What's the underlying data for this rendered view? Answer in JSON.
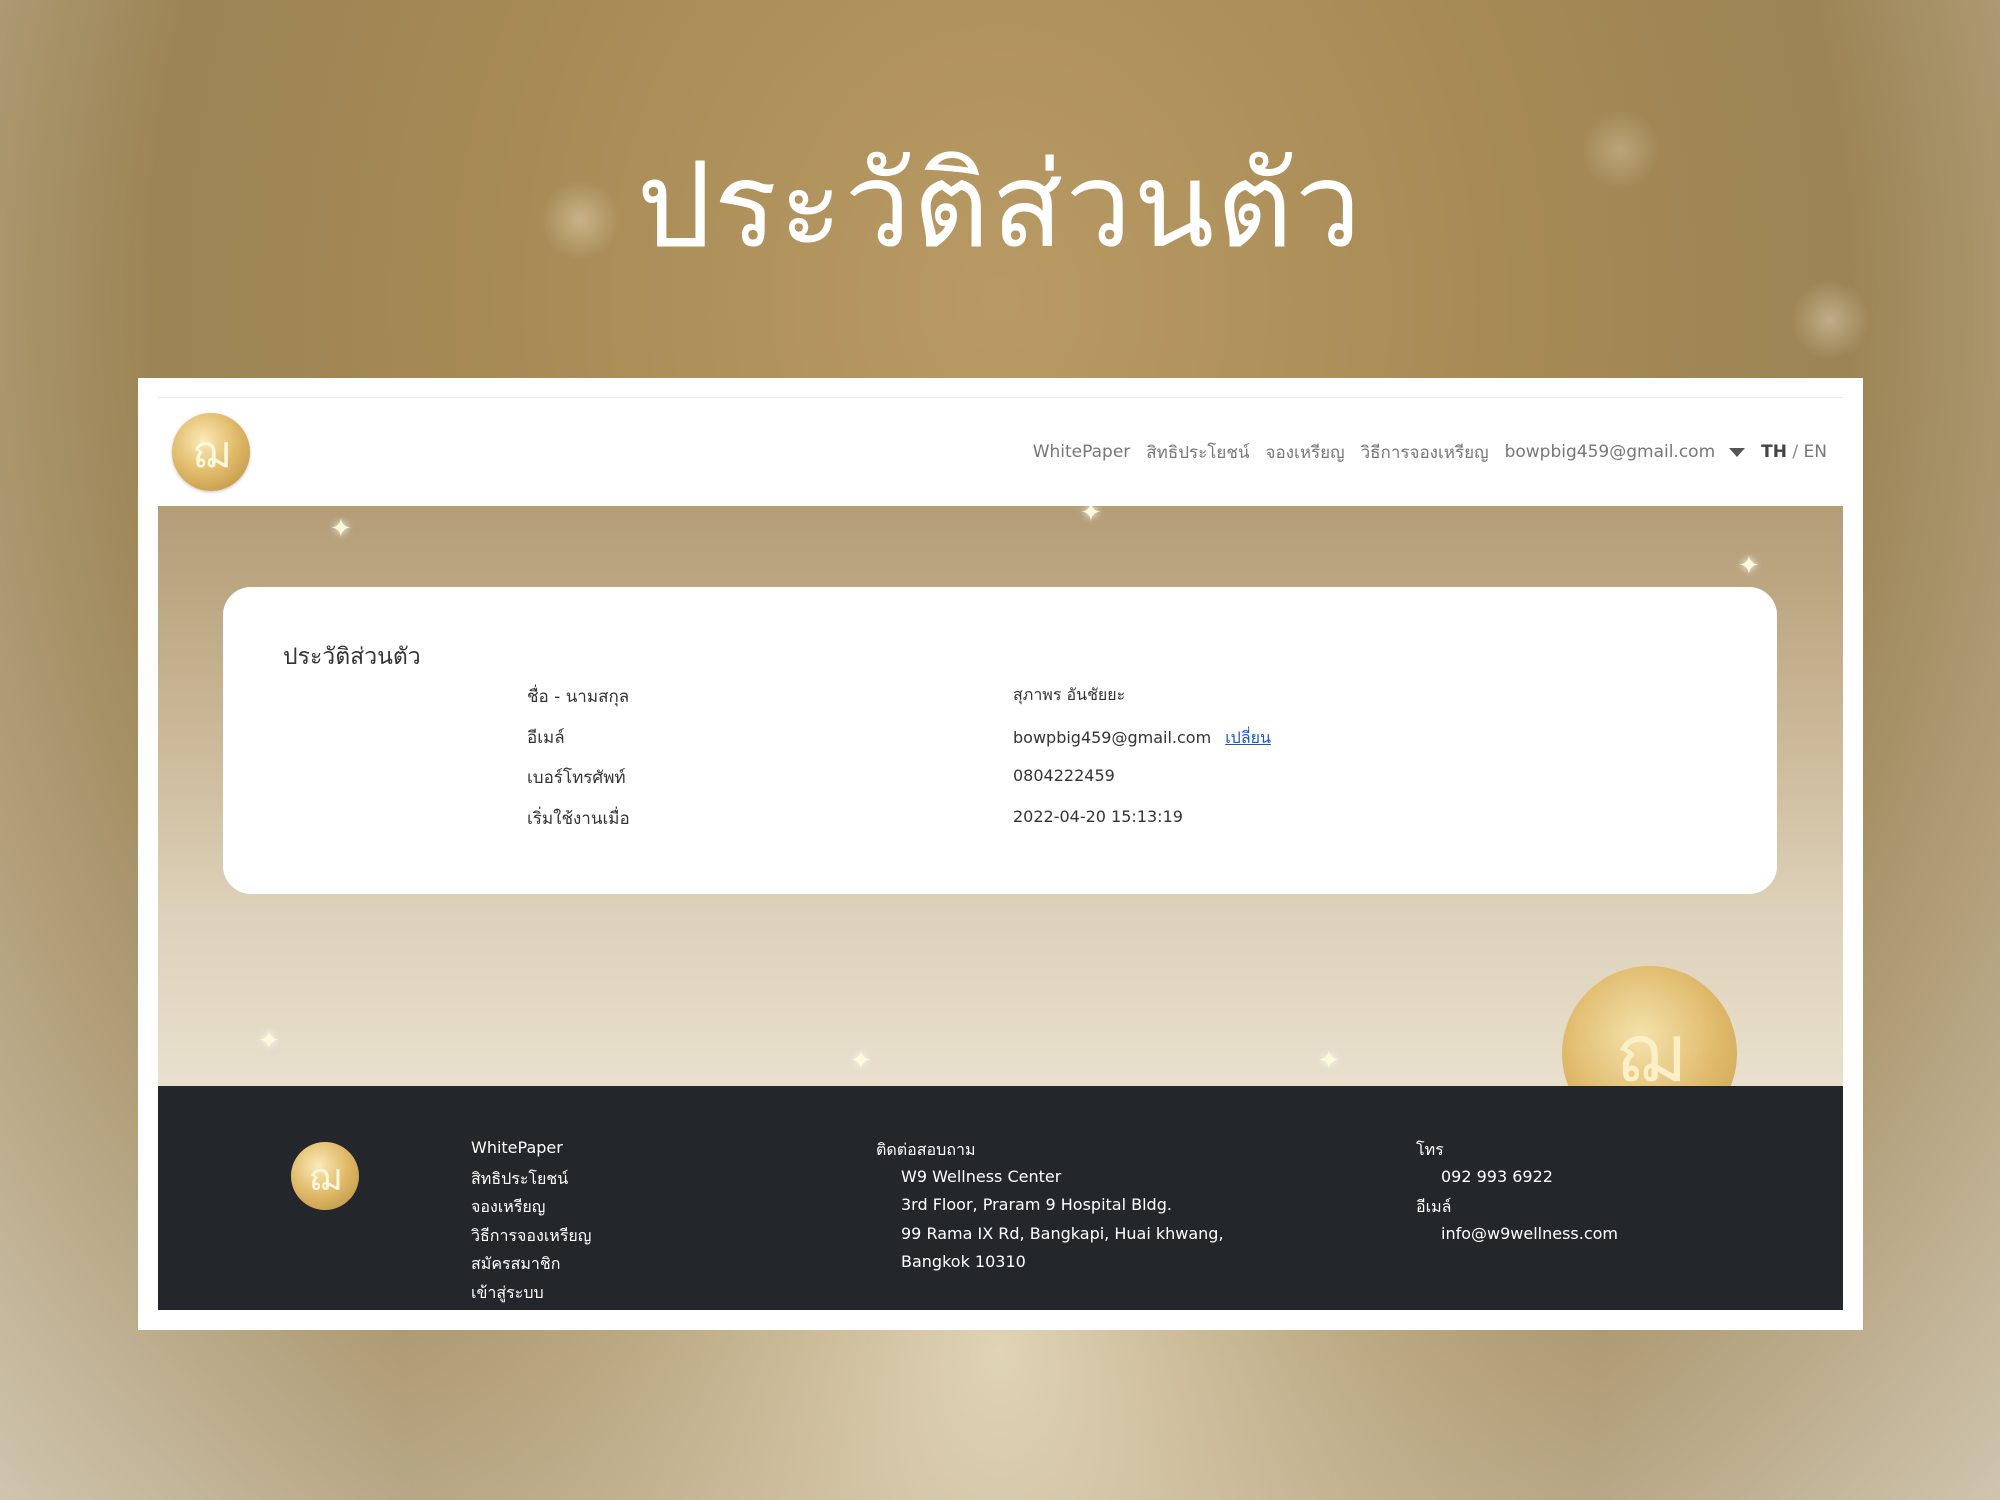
{
  "slide": {
    "title": "ประวัติส่วนตัว"
  },
  "nav": {
    "links": [
      "WhitePaper",
      "สิทธิประโยชน์",
      "จองเหรียญ",
      "วิธีการจองเหรียญ"
    ],
    "user_email": "bowpbig459@gmail.com",
    "lang_th": "TH",
    "lang_sep": "/",
    "lang_en": "EN"
  },
  "profile": {
    "heading": "ประวัติส่วนตัว",
    "rows": [
      {
        "label": "ชื่อ - นามสกุล",
        "value": "สุภาพร อันชัยยะ"
      },
      {
        "label": "อีเมล์",
        "value": "bowpbig459@gmail.com"
      },
      {
        "label": "เบอร์โทรศัพท์",
        "value": "0804222459"
      },
      {
        "label": "เริ่มใช้งานเมื่อ",
        "value": "2022-04-20 15:13:19"
      }
    ],
    "change_link": "เปลี่ยน"
  },
  "footer": {
    "links": [
      "WhitePaper",
      "สิทธิประโยชน์",
      "จองเหรียญ",
      "วิธีการจองเหรียญ",
      "สมัครสมาชิก",
      "เข้าสู่ระบบ"
    ],
    "contact": {
      "heading": "ติดต่อสอบถาม",
      "lines": [
        "W9 Wellness Center",
        "3rd Floor, Praram 9 Hospital Bldg.",
        "99 Rama IX Rd, Bangkapi, Huai khwang,",
        "Bangkok 10310"
      ]
    },
    "phone_label": "โทร",
    "phone": "092 993 6922",
    "email_label": "อีเมล์",
    "email": "info@w9wellness.com"
  },
  "colors": {
    "gold": "#c9a55a",
    "footer_bg": "#23262b",
    "link": "#1a56c8"
  },
  "icons": {
    "logo": "coin-logo-icon",
    "dropdown": "caret-down-icon"
  }
}
